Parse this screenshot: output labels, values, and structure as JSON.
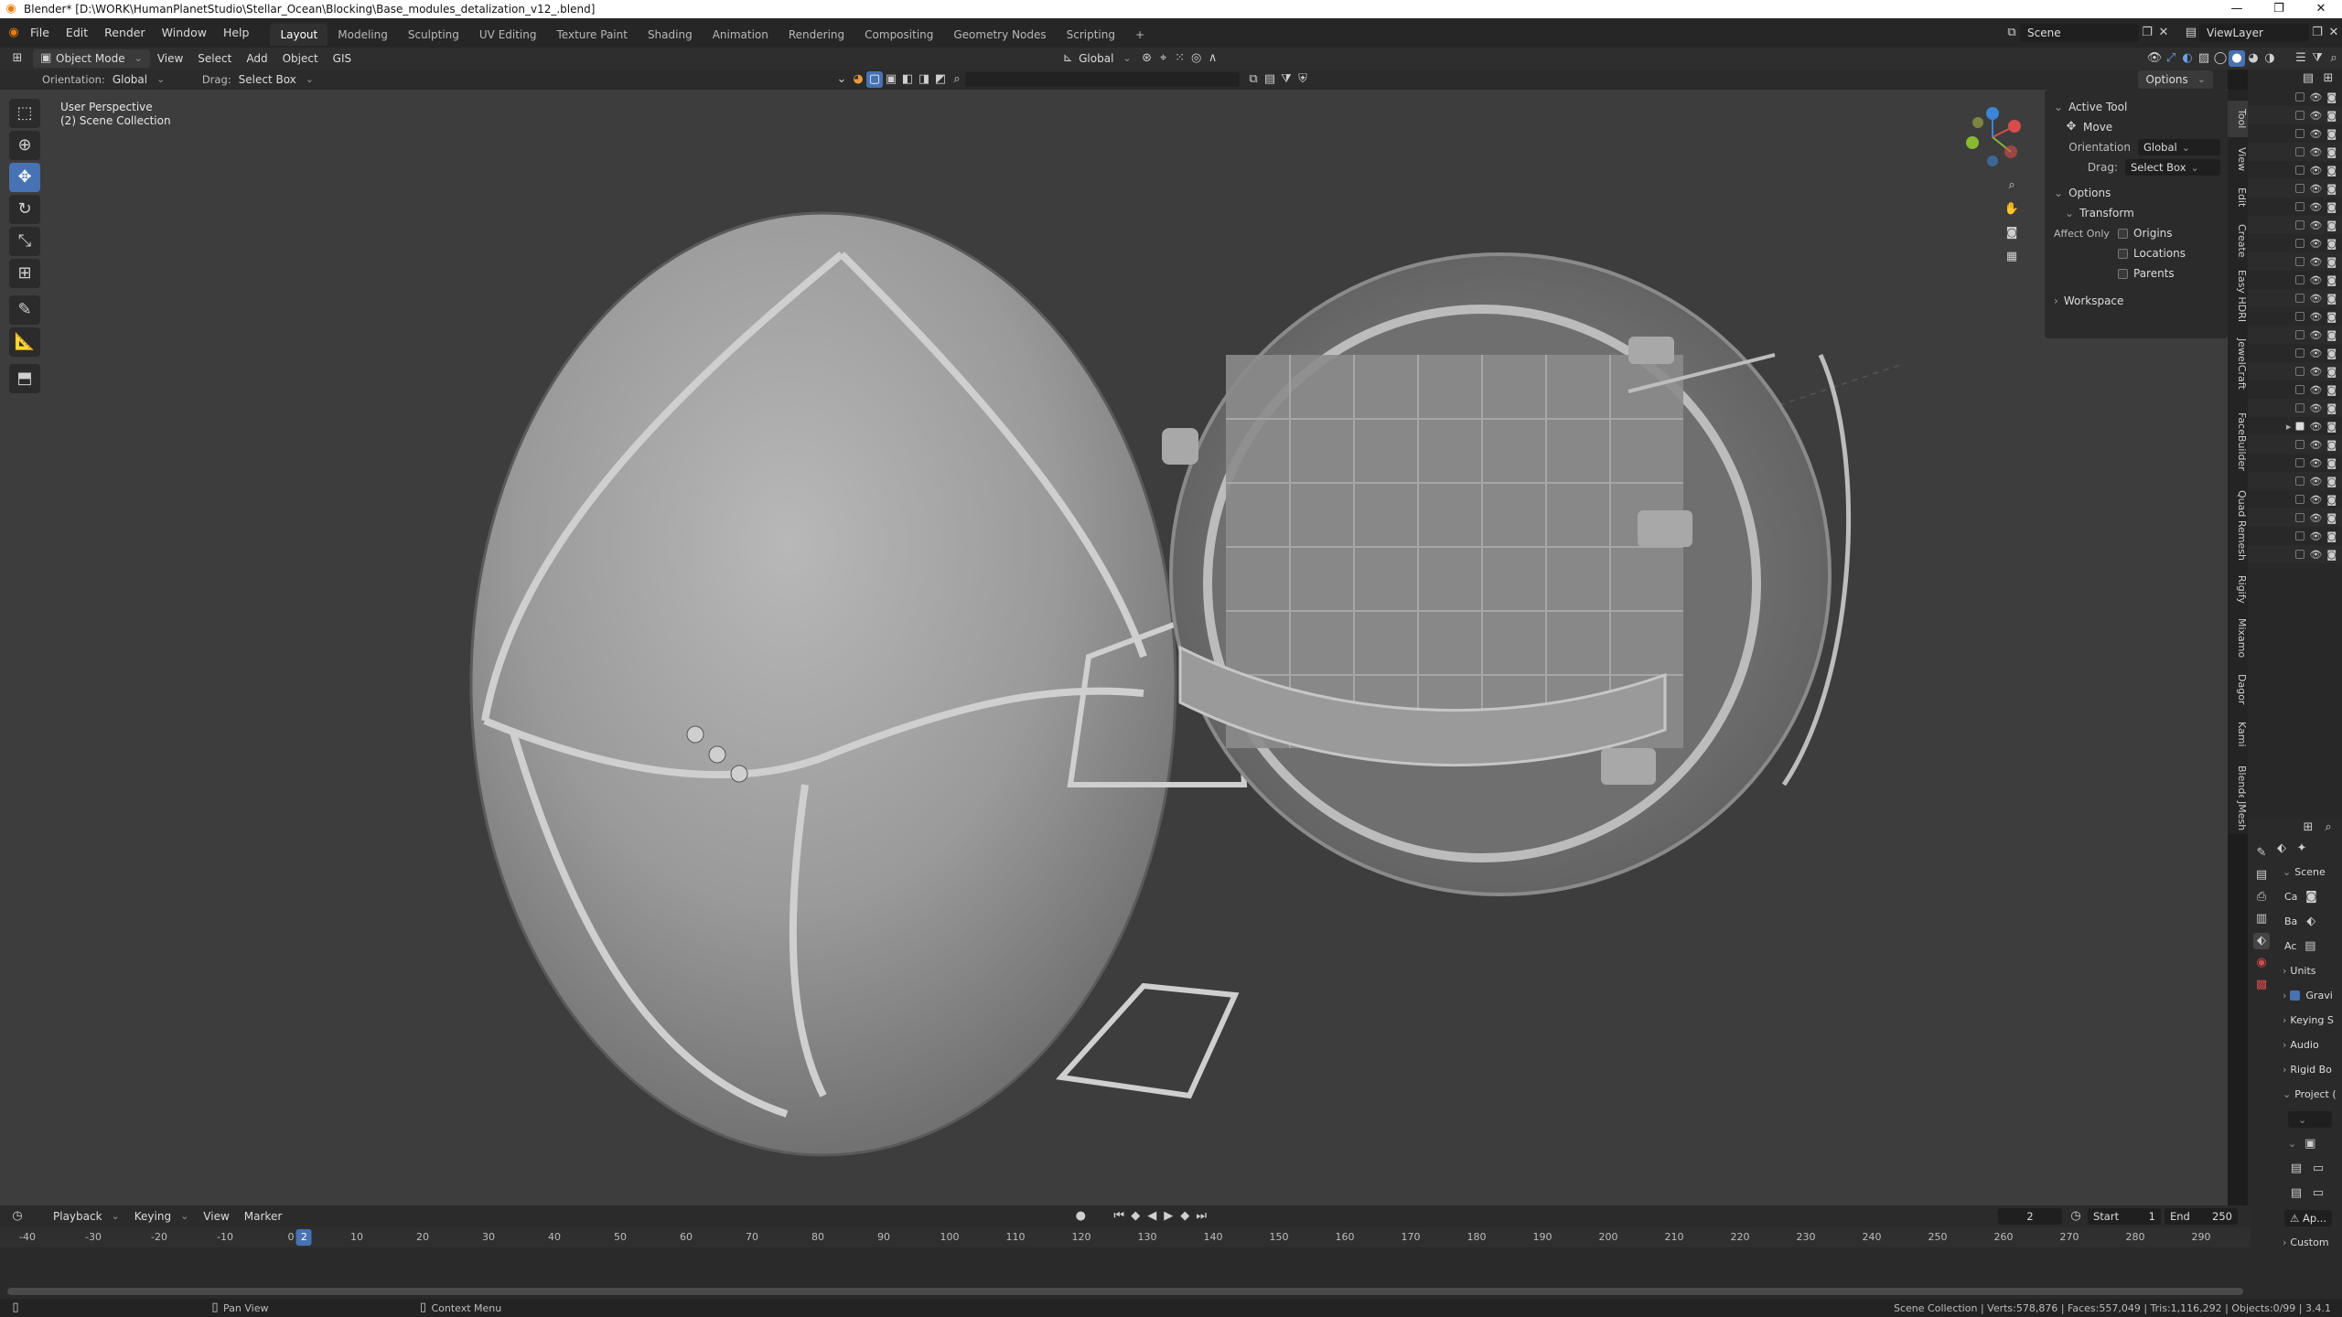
{
  "window": {
    "title": "Blender* [D:\\WORK\\HumanPlanetStudio\\Stellar_Ocean\\Blocking\\Base_modules_detalization_v12_.blend]",
    "controls": [
      "—",
      "❐",
      "✕"
    ]
  },
  "menubar": {
    "menus": [
      "File",
      "Edit",
      "Render",
      "Window",
      "Help"
    ],
    "workspaces": [
      "Layout",
      "Modeling",
      "Sculpting",
      "UV Editing",
      "Texture Paint",
      "Shading",
      "Animation",
      "Rendering",
      "Compositing",
      "Geometry Nodes",
      "Scripting"
    ],
    "active_workspace": "Layout",
    "add_tab": "+",
    "scene_label": "Scene",
    "view_layer_label": "ViewLayer"
  },
  "header3d": {
    "mode": "Object Mode",
    "menus": [
      "View",
      "Select",
      "Add",
      "Object",
      "GIS"
    ],
    "transform_orientation": "Global"
  },
  "toolsettings": {
    "orientation_label": "Orientation:",
    "orientation_value": "Global",
    "drag_label": "Drag:",
    "drag_value": "Select Box",
    "options_label": "Options"
  },
  "viewport": {
    "perspective": "User Perspective",
    "collection": "(2) Scene Collection",
    "gizmo_axes": [
      "X",
      "Y",
      "Z"
    ]
  },
  "tools": [
    "select-box",
    "cursor",
    "move",
    "rotate",
    "scale",
    "transform",
    "annotate",
    "measure",
    "add-cube"
  ],
  "active_tool_index": 2,
  "npanel": {
    "active_tool_header": "Active Tool",
    "tool_name": "Move",
    "orientation_label": "Orientation",
    "orientation_value": "Global",
    "drag_label": "Drag:",
    "drag_value": "Select Box",
    "options_header": "Options",
    "transform_header": "Transform",
    "affect_only_label": "Affect Only",
    "affect_items": [
      "Origins",
      "Locations",
      "Parents"
    ],
    "workspace_header": "Workspace"
  },
  "vertical_tabs": [
    "Tool",
    "View",
    "Edit",
    "Create",
    "Easy HDRI",
    "JewelCraft",
    "FaceBuilder",
    "Quad Remesh",
    "Rigify",
    "Mixamo",
    "Dagor",
    "Kami",
    "BlenderKit",
    "JMesh"
  ],
  "outliner": {
    "row_count": 26,
    "expanded_row_index": 18
  },
  "properties": {
    "scene_label": "Scene",
    "fields": [
      "Ca",
      "Ba",
      "Ac"
    ],
    "sections": [
      "Units",
      "Gravi",
      "Keying S",
      "Audio",
      "Rigid Bo",
      "Project (",
      "Ap...",
      "Custom"
    ]
  },
  "timeline": {
    "menus": [
      "Playback",
      "Keying",
      "View",
      "Marker"
    ],
    "current_frame": "2",
    "start_label": "Start",
    "start_value": "1",
    "end_label": "End",
    "end_value": "250",
    "ruler": [
      "-40",
      "-30",
      "-20",
      "-10",
      "0",
      "10",
      "20",
      "30",
      "40",
      "50",
      "60",
      "70",
      "80",
      "90",
      "100",
      "110",
      "120",
      "130",
      "140",
      "150",
      "160",
      "170",
      "180",
      "190",
      "200",
      "210",
      "220",
      "230",
      "240",
      "250",
      "260",
      "270",
      "280",
      "290"
    ],
    "playhead_label": "2"
  },
  "statusbar": {
    "left_hint": "Pan View",
    "mid_hint": "Context Menu",
    "stats": "Scene Collection | Verts:578,876 | Faces:557,049 | Tris:1,116,292 | Objects:0/99 | 3.4.1"
  },
  "colors": {
    "accent": "#4772b3",
    "viewport_bg": "#3d3d3d",
    "x_axis": "#d94c4c",
    "y_axis": "#8ab833",
    "z_axis": "#3b84d6",
    "playhead": "#4772b3"
  }
}
